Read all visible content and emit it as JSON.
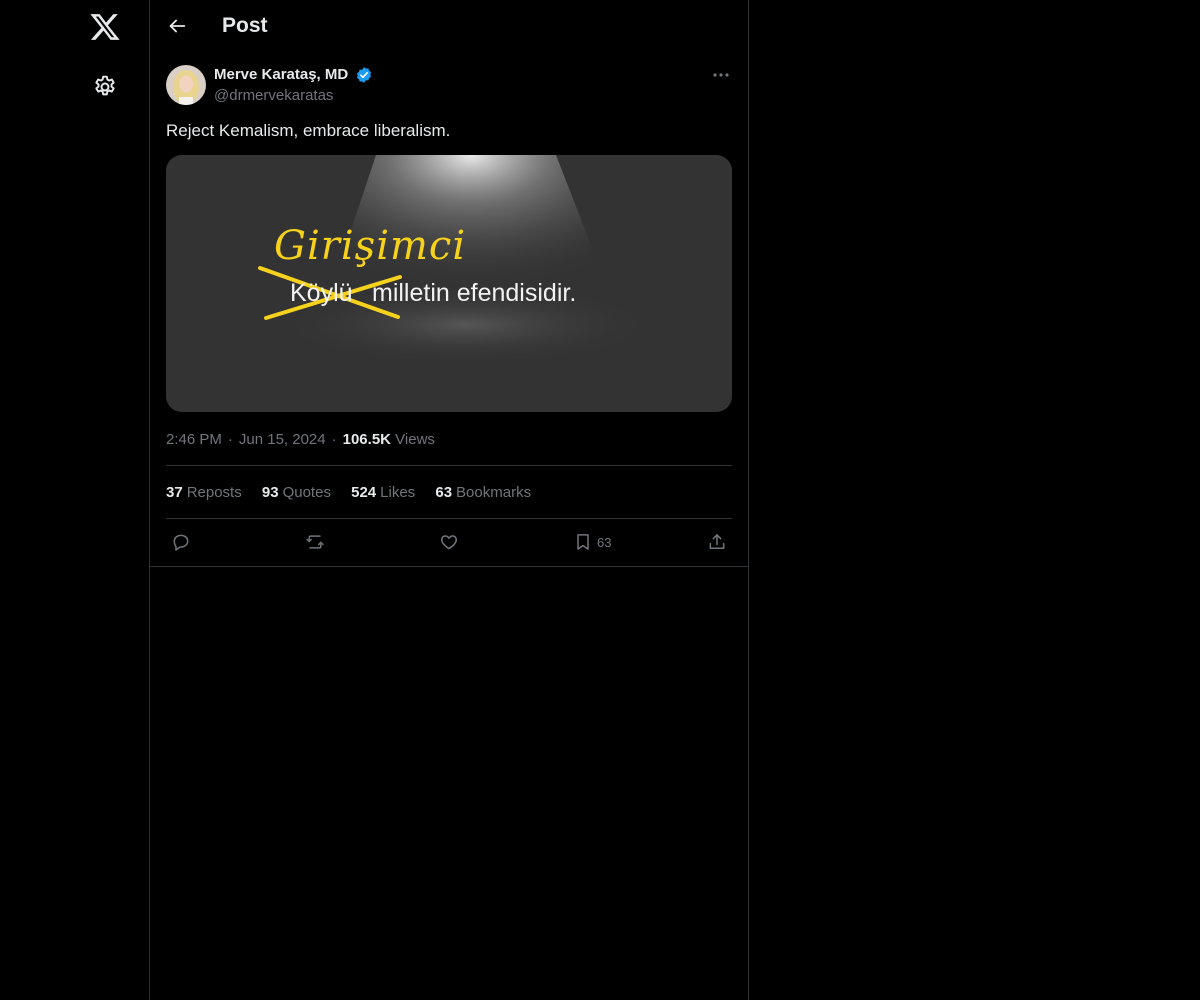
{
  "header": {
    "title": "Post"
  },
  "post": {
    "author_name": "Merve Karataş, MD",
    "handle": "@drmervekaratas",
    "text": "Reject Kemalism, embrace liberalism.",
    "media": {
      "handwritten_word": "Girişimci",
      "struck_word": "Köylü",
      "rest_text": "milletin efendisidir."
    },
    "time": "2:46 PM",
    "date": "Jun 15, 2024",
    "views_count": "106.5K",
    "views_label": "Views"
  },
  "stats": {
    "reposts": {
      "count": "37",
      "label": "Reposts"
    },
    "quotes": {
      "count": "93",
      "label": "Quotes"
    },
    "likes": {
      "count": "524",
      "label": "Likes"
    },
    "bookmarks": {
      "count": "63",
      "label": "Bookmarks"
    }
  },
  "actions": {
    "bookmark_count": "63"
  },
  "icons": {
    "logo": "x-logo-icon",
    "settings": "gear-icon",
    "back": "arrow-left-icon",
    "verified": "verified-badge-icon",
    "more": "more-horizontal-icon",
    "reply": "reply-icon",
    "repost": "repost-icon",
    "like": "heart-icon",
    "bookmark": "bookmark-icon",
    "share": "share-icon"
  },
  "colors": {
    "background": "#000000",
    "verified": "#1d9bf0",
    "handwriting": "#f7d21d",
    "muted": "#71767b",
    "text": "#e7e9ea"
  }
}
